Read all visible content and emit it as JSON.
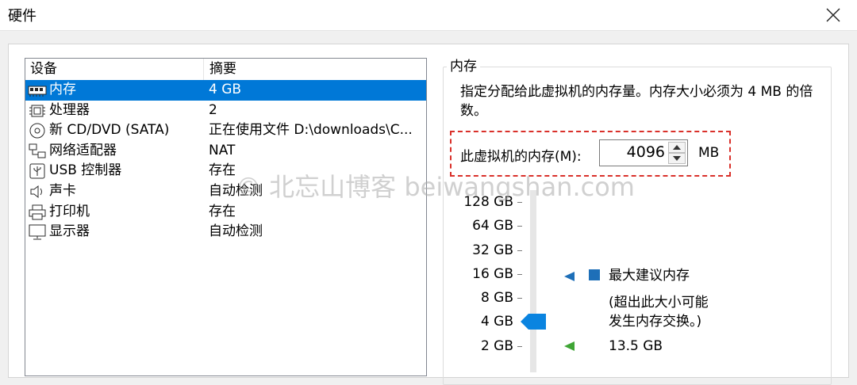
{
  "window": {
    "title": "硬件"
  },
  "device_list": {
    "headers": {
      "device": "设备",
      "summary": "摘要"
    },
    "rows": [
      {
        "name": "内存",
        "summary": "4 GB",
        "icon": "memory-icon",
        "selected": true
      },
      {
        "name": "处理器",
        "summary": "2",
        "icon": "cpu-icon"
      },
      {
        "name": "新 CD/DVD (SATA)",
        "summary": "正在使用文件 D:\\downloads\\C...",
        "icon": "cd-dvd-icon"
      },
      {
        "name": "网络适配器",
        "summary": "NAT",
        "icon": "network-icon"
      },
      {
        "name": "USB 控制器",
        "summary": "存在",
        "icon": "usb-icon"
      },
      {
        "name": "声卡",
        "summary": "自动检测",
        "icon": "speaker-icon"
      },
      {
        "name": "打印机",
        "summary": "存在",
        "icon": "printer-icon"
      },
      {
        "name": "显示器",
        "summary": "自动检测",
        "icon": "monitor-icon"
      }
    ]
  },
  "memory": {
    "group_title": "内存",
    "description": "指定分配给此虚拟机的内存量。内存大小必须为 4 MB 的倍数。",
    "input_label": "此虚拟机的内存(M):",
    "value": "4096",
    "unit": "MB",
    "scale_labels": [
      "128 GB",
      "64 GB",
      "32 GB",
      "16 GB",
      "8 GB",
      "4 GB",
      "2 GB"
    ],
    "legend": {
      "max_recommended": "最大建议内存",
      "max_note_line1": "(超出此大小可能",
      "max_note_line2": "发生内存交换。)",
      "recommended_value": "13.5 GB"
    },
    "colors": {
      "max_marker": "#1e6fb8",
      "recommended_marker": "#3fa535",
      "thumb": "#0a84e0"
    }
  },
  "watermark": "© 北忘山博客 beiwangshan.com"
}
